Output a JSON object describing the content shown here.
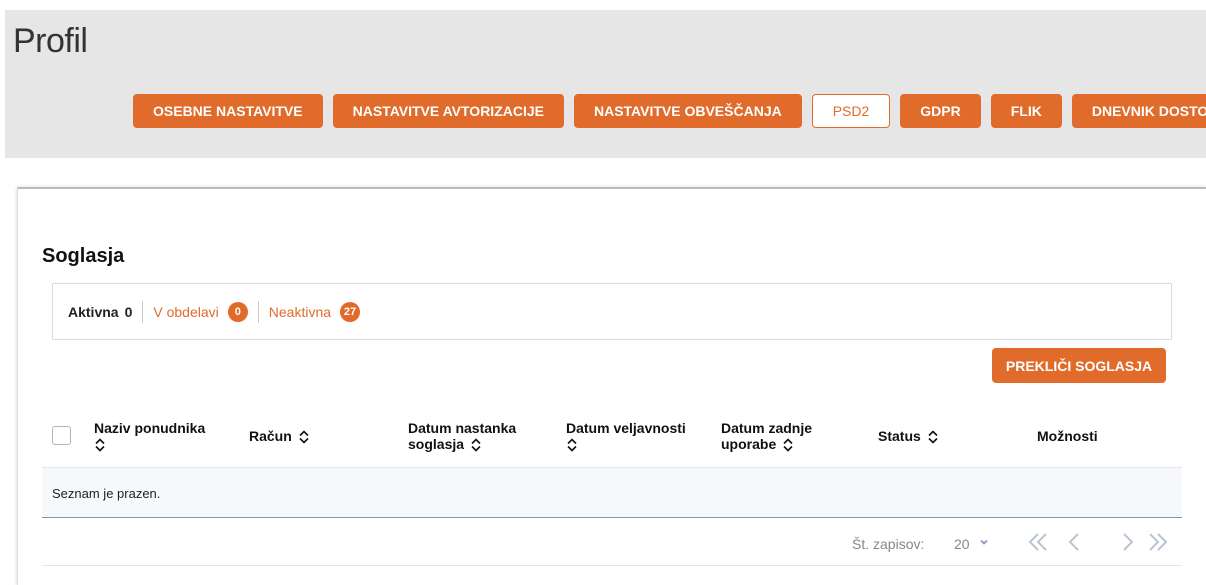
{
  "header": {
    "title": "Profil",
    "nav": [
      {
        "label": "OSEBNE NASTAVITVE",
        "active": false
      },
      {
        "label": "NASTAVITVE AVTORIZACIJE",
        "active": false
      },
      {
        "label": "NASTAVITVE OBVEŠČANJA",
        "active": false
      },
      {
        "label": "PSD2",
        "active": true
      },
      {
        "label": "GDPR",
        "active": false
      },
      {
        "label": "FLIK",
        "active": false
      },
      {
        "label": "DNEVNIK DOSTOPOV",
        "active": false
      }
    ]
  },
  "consents": {
    "title": "Soglasja",
    "filters": {
      "active_label": "Aktivna",
      "active_count": "0",
      "pending_label": "V obdelavi",
      "pending_count": "0",
      "inactive_label": "Neaktivna",
      "inactive_count": "27"
    },
    "cancel_button": "PREKLIČI SOGLASJA",
    "columns": [
      {
        "line1": "Naziv ponudnika",
        "line2": ""
      },
      {
        "line1": "Račun",
        "line2": ""
      },
      {
        "line1": "Datum nastanka",
        "line2": "soglasja"
      },
      {
        "line1": "Datum veljavnosti",
        "line2": ""
      },
      {
        "line1": "Datum zadnje",
        "line2": "uporabe"
      },
      {
        "line1": "Status",
        "line2": ""
      },
      {
        "line1": "Možnosti",
        "line2": ""
      }
    ],
    "empty_text": "Seznam je prazen.",
    "pagination": {
      "records_label": "Št. zapisov:",
      "records_value": "20"
    }
  },
  "colors": {
    "accent": "#e06b2a",
    "header_bg": "#e6e6e6"
  },
  "icons": [
    "sort-icon",
    "chevron-down-icon",
    "first-page-icon",
    "prev-page-icon",
    "next-page-icon",
    "last-page-icon",
    "checkbox-icon"
  ]
}
